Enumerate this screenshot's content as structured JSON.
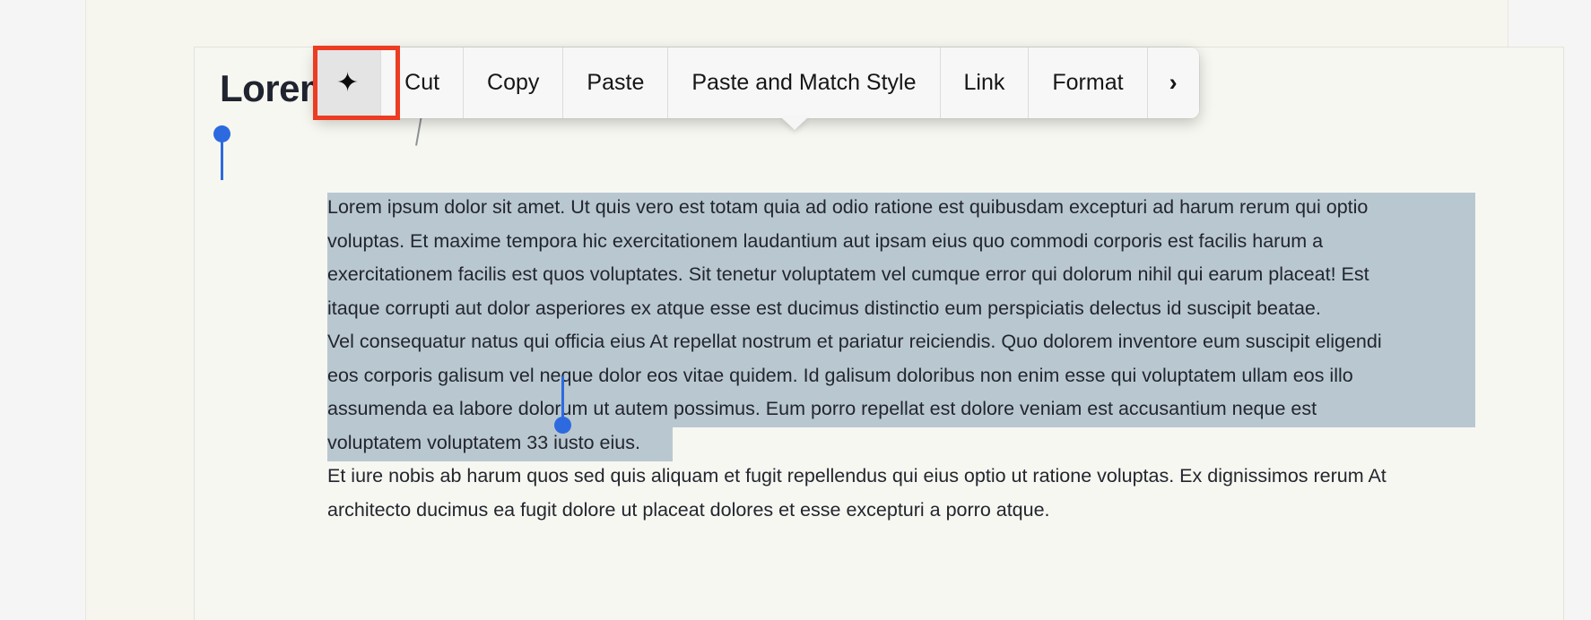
{
  "document": {
    "title": "Lorem",
    "paragraph_1_lines": [
      "Lorem ipsum dolor sit amet. Ut quis vero est totam quia ad odio ratione est quibusdam excepturi ad harum rerum qui optio",
      "voluptas. Et maxime tempora hic exercitationem laudantium aut ipsam eius quo commodi corporis est facilis harum a",
      "exercitationem facilis est quos voluptates. Sit tenetur voluptatem vel cumque error qui dolorum nihil qui earum placeat! Est",
      "itaque corrupti aut dolor asperiores ex atque esse est ducimus distinctio eum perspiciatis delectus id suscipit beatae.",
      "Vel consequatur natus qui officia eius At repellat nostrum et pariatur reiciendis. Quo dolorem inventore eum suscipit eligendi",
      "eos corporis galisum vel neque dolor eos vitae quidem. Id galisum doloribus non enim esse qui voluptatem ullam eos illo",
      "assumenda ea labore dolorum ut autem possimus. Eum porro repellat est dolore veniam est accusantium neque est",
      "voluptatem voluptatem 33 iusto eius."
    ],
    "paragraph_2_lines": [
      "Et iure nobis ab harum quos sed quis aliquam et fugit repellendus qui eius optio ut ratione voluptas. Ex dignissimos rerum At",
      "architecto ducimus ea fugit dolore ut placeat dolores et esse excepturi a porro atque."
    ]
  },
  "context_menu": {
    "items": [
      {
        "label": "✦",
        "name": "ai-sparkle-icon",
        "kind": "icon"
      },
      {
        "label": "Cut",
        "name": "cut",
        "kind": "text"
      },
      {
        "label": "Copy",
        "name": "copy",
        "kind": "text"
      },
      {
        "label": "Paste",
        "name": "paste",
        "kind": "text"
      },
      {
        "label": "Paste and Match Style",
        "name": "paste-and-match-style",
        "kind": "text"
      },
      {
        "label": "Link",
        "name": "link",
        "kind": "text"
      },
      {
        "label": "Format",
        "name": "format",
        "kind": "text"
      },
      {
        "label": "›",
        "name": "more-chevron",
        "kind": "chevron"
      }
    ]
  },
  "annotation": {
    "highlight_color": "#ec3c22",
    "target": "ai-sparkle-button"
  },
  "colors": {
    "selection": "#b9c7d0",
    "handle": "#2d6ae0",
    "page_background": "#f6f6ef",
    "card_background": "#f7f7f1",
    "text": "#22262e"
  }
}
